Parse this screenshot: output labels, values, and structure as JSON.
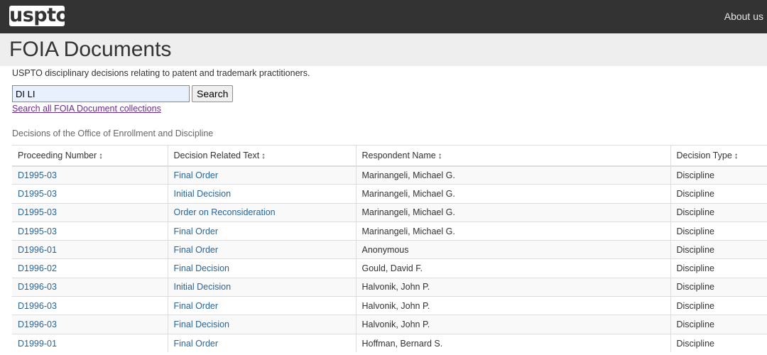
{
  "header": {
    "logo": "uspto",
    "about_label": "About us"
  },
  "page": {
    "title": "FOIA Documents",
    "subtitle": "USPTO disciplinary decisions relating to patent and trademark practitioners."
  },
  "search": {
    "value": "DI LI",
    "button_label": "Search",
    "all_collections_link": "Search all FOIA Document collections"
  },
  "section_caption": "Decisions of the Office of Enrollment and Discipline",
  "table": {
    "columns": [
      "Proceeding Number",
      "Decision Related Text",
      "Respondent Name",
      "Decision Type"
    ],
    "sort_icon": "↕",
    "rows": [
      [
        "D1995-03",
        "Final Order",
        "Marinangeli, Michael G.",
        "Discipline"
      ],
      [
        "D1995-03",
        "Initial Decision",
        "Marinangeli, Michael G.",
        "Discipline"
      ],
      [
        "D1995-03",
        "Order on Reconsideration",
        "Marinangeli, Michael G.",
        "Discipline"
      ],
      [
        "D1995-03",
        "Final Order",
        "Marinangeli, Michael G.",
        "Discipline"
      ],
      [
        "D1996-01",
        "Final Order",
        "Anonymous",
        "Discipline"
      ],
      [
        "D1996-02",
        "Final Decision",
        "Gould, David F.",
        "Discipline"
      ],
      [
        "D1996-03",
        "Initial Decision",
        "Halvonik, John P.",
        "Discipline"
      ],
      [
        "D1996-03",
        "Final Order",
        "Halvonik, John P.",
        "Discipline"
      ],
      [
        "D1996-03",
        "Final Decision",
        "Halvonik, John P.",
        "Discipline"
      ],
      [
        "D1999-01",
        "Final Order",
        "Hoffman, Bernard S.",
        "Discipline"
      ]
    ]
  }
}
